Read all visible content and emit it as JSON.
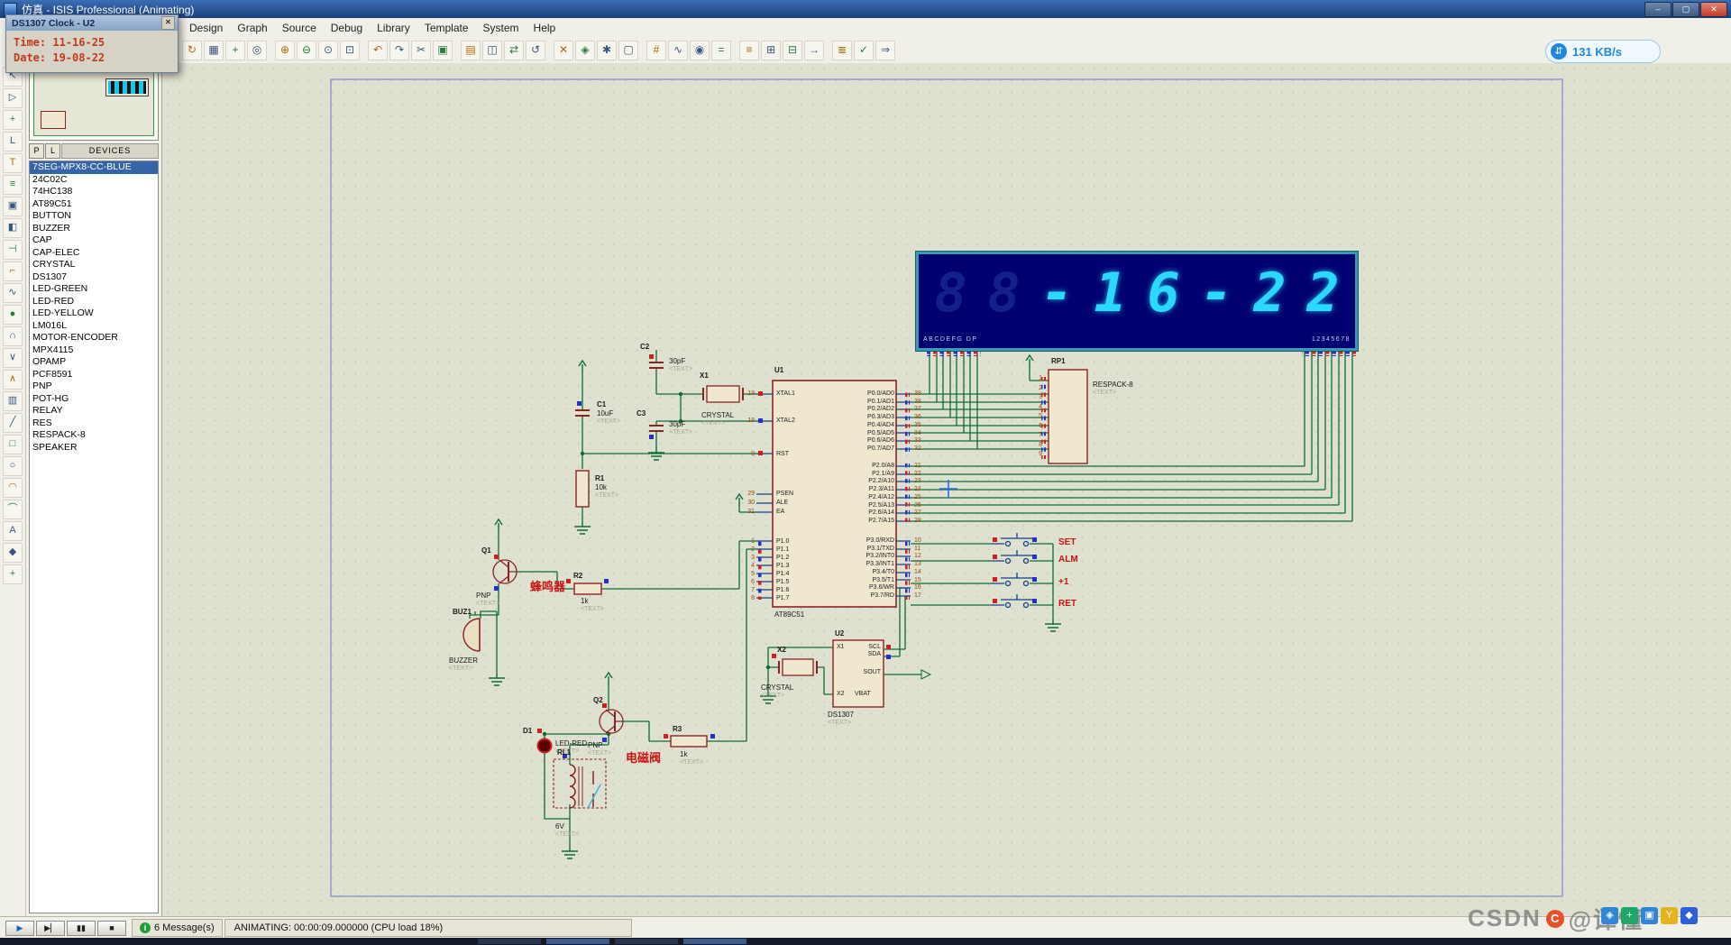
{
  "titlebar": {
    "title": "仿真 - ISIS Professional (Animating)",
    "window_controls": [
      {
        "name": "minimize-button",
        "glyph": "–"
      },
      {
        "name": "maximize-button",
        "glyph": "▢"
      },
      {
        "name": "close-button",
        "glyph": "✕"
      }
    ]
  },
  "popup": {
    "title": "DS1307 Clock - U2",
    "close_glyph": "✕",
    "lines": [
      "Time: 11-16-25",
      "Date: 19-08-22"
    ]
  },
  "menubar": {
    "items": [
      "Design",
      "Graph",
      "Source",
      "Debug",
      "Library",
      "Template",
      "System",
      "Help"
    ]
  },
  "toolbar": {
    "icons": [
      {
        "name": "redraw-icon",
        "glyph": "↻"
      },
      {
        "name": "grid-toggle-icon",
        "glyph": "▦"
      },
      {
        "name": "false-origin-icon",
        "glyph": "+"
      },
      {
        "name": "pan-icon",
        "glyph": "◎"
      },
      {
        "name": "zoom-in-icon",
        "glyph": "⊕"
      },
      {
        "name": "zoom-out-icon",
        "glyph": "⊖"
      },
      {
        "name": "zoom-all-icon",
        "glyph": "⊙"
      },
      {
        "name": "zoom-area-icon",
        "glyph": "⊡"
      },
      {
        "name": "undo-icon",
        "glyph": "↶"
      },
      {
        "name": "redo-icon",
        "glyph": "↷"
      },
      {
        "name": "cut-icon",
        "glyph": "✂"
      },
      {
        "name": "copy-icon",
        "glyph": "▣"
      },
      {
        "name": "paste-icon",
        "glyph": "▤"
      },
      {
        "name": "block-copy-icon",
        "glyph": "◫"
      },
      {
        "name": "block-move-icon",
        "glyph": "⇄"
      },
      {
        "name": "block-rotate-icon",
        "glyph": "↺"
      },
      {
        "name": "block-delete-icon",
        "glyph": "✕"
      },
      {
        "name": "pick-device-icon",
        "glyph": "◈"
      },
      {
        "name": "make-device-icon",
        "glyph": "✱"
      },
      {
        "name": "packaging-tool-icon",
        "glyph": "▢"
      },
      {
        "name": "decompose-icon",
        "glyph": "#"
      },
      {
        "name": "wire-autorouter-icon",
        "glyph": "∿"
      },
      {
        "name": "search-tag-icon",
        "glyph": "◉"
      },
      {
        "name": "property-assignment-icon",
        "glyph": "="
      },
      {
        "name": "design-explorer-icon",
        "glyph": "≡"
      },
      {
        "name": "new-sheet-icon",
        "glyph": "⊞"
      },
      {
        "name": "remove-sheet-icon",
        "glyph": "⊟"
      },
      {
        "name": "goto-sheet-icon",
        "glyph": "→"
      },
      {
        "name": "bom-icon",
        "glyph": "≣"
      },
      {
        "name": "electrical-check-icon",
        "glyph": "✓"
      },
      {
        "name": "netlist-to-ares-icon",
        "glyph": "⇒"
      }
    ],
    "net_badge": {
      "icon_glyph": "⇵",
      "speed": "131 KB/s"
    }
  },
  "modebar": {
    "icons": [
      {
        "name": "selection-mode-icon",
        "glyph": "↖"
      },
      {
        "name": "component-mode-icon",
        "glyph": "▷"
      },
      {
        "name": "junction-dot-mode-icon",
        "glyph": "+"
      },
      {
        "name": "wire-label-mode-icon",
        "glyph": "L"
      },
      {
        "name": "text-script-mode-icon",
        "glyph": "T"
      },
      {
        "name": "buses-mode-icon",
        "glyph": "≡"
      },
      {
        "name": "subcircuit-mode-icon",
        "glyph": "▣"
      },
      {
        "name": "instant-edit-mode-icon",
        "glyph": "◧"
      },
      {
        "name": "intersheet-terminal-mode-icon",
        "glyph": "⊣"
      },
      {
        "name": "device-pins-mode-icon",
        "glyph": "⌐"
      },
      {
        "name": "graph-mode-icon",
        "glyph": "∿"
      },
      {
        "name": "tape-recorder-mode-icon",
        "glyph": "●"
      },
      {
        "name": "generator-mode-icon",
        "glyph": "∩"
      },
      {
        "name": "voltage-probe-mode-icon",
        "glyph": "∨"
      },
      {
        "name": "current-probe-mode-icon",
        "glyph": "∧"
      },
      {
        "name": "virtual-instruments-mode-icon",
        "glyph": "▥"
      },
      {
        "name": "2d-line-mode-icon",
        "glyph": "╱"
      },
      {
        "name": "2d-box-mode-icon",
        "glyph": "□"
      },
      {
        "name": "2d-circle-mode-icon",
        "glyph": "○"
      },
      {
        "name": "2d-arc-mode-icon",
        "glyph": "◠"
      },
      {
        "name": "2d-path-mode-icon",
        "glyph": "⌒"
      },
      {
        "name": "2d-text-mode-icon",
        "glyph": "A"
      },
      {
        "name": "2d-symbol-mode-icon",
        "glyph": "◆"
      },
      {
        "name": "2d-marker-mode-icon",
        "glyph": "+"
      }
    ]
  },
  "panel": {
    "pl_buttons": [
      "P",
      "L"
    ],
    "header": "DEVICES",
    "devices": [
      "7SEG-MPX8-CC-BLUE",
      "24C02C",
      "74HC138",
      "AT89C51",
      "BUTTON",
      "BUZZER",
      "CAP",
      "CAP-ELEC",
      "CRYSTAL",
      "DS1307",
      "LED-GREEN",
      "LED-RED",
      "LED-YELLOW",
      "LM016L",
      "MOTOR-ENCODER",
      "MPX4115",
      "OPAMP",
      "PCF8591",
      "PNP",
      "POT-HG",
      "RELAY",
      "RES",
      "RESPACK-8",
      "SPEAKER"
    ]
  },
  "display": {
    "digits": [
      "8",
      "8",
      "-",
      "1",
      "6",
      "-",
      "2",
      "2"
    ],
    "segment_label": "ABCDEFG DP",
    "digit_label": "12345678"
  },
  "circuit": {
    "u1": {
      "ref": "U1",
      "part": "AT89C51",
      "xtal": [
        {
          "n": "19",
          "name": "XTAL1"
        },
        {
          "n": "18",
          "name": "XTAL2"
        }
      ],
      "rst": [
        {
          "n": "9",
          "name": "RST"
        }
      ],
      "ctrl": [
        {
          "n": "29",
          "name": "PSEN"
        },
        {
          "n": "30",
          "name": "ALE"
        },
        {
          "n": "31",
          "name": "EA"
        }
      ],
      "p1": [
        {
          "n": "1",
          "name": "P1.0"
        },
        {
          "n": "2",
          "name": "P1.1"
        },
        {
          "n": "3",
          "name": "P1.2"
        },
        {
          "n": "4",
          "name": "P1.3"
        },
        {
          "n": "5",
          "name": "P1.4"
        },
        {
          "n": "6",
          "name": "P1.5"
        },
        {
          "n": "7",
          "name": "P1.6"
        },
        {
          "n": "8",
          "name": "P1.7"
        }
      ],
      "p0": [
        {
          "n": "39",
          "name": "P0.0/AD0"
        },
        {
          "n": "38",
          "name": "P0.1/AD1"
        },
        {
          "n": "37",
          "name": "P0.2/AD2"
        },
        {
          "n": "36",
          "name": "P0.3/AD3"
        },
        {
          "n": "35",
          "name": "P0.4/AD4"
        },
        {
          "n": "34",
          "name": "P0.5/AD5"
        },
        {
          "n": "33",
          "name": "P0.6/AD6"
        },
        {
          "n": "32",
          "name": "P0.7/AD7"
        }
      ],
      "p2": [
        {
          "n": "21",
          "name": "P2.0/A8"
        },
        {
          "n": "22",
          "name": "P2.1/A9"
        },
        {
          "n": "23",
          "name": "P2.2/A10"
        },
        {
          "n": "24",
          "name": "P2.3/A11"
        },
        {
          "n": "25",
          "name": "P2.4/A12"
        },
        {
          "n": "26",
          "name": "P2.5/A13"
        },
        {
          "n": "27",
          "name": "P2.6/A14"
        },
        {
          "n": "28",
          "name": "P2.7/A15"
        }
      ],
      "p3": [
        {
          "n": "10",
          "name": "P3.0/RXD"
        },
        {
          "n": "11",
          "name": "P3.1/TXD"
        },
        {
          "n": "12",
          "name": "P3.2/INT0"
        },
        {
          "n": "13",
          "name": "P3.3/INT1"
        },
        {
          "n": "14",
          "name": "P3.4/T0"
        },
        {
          "n": "15",
          "name": "P3.5/T1"
        },
        {
          "n": "16",
          "name": "P3.6/WR"
        },
        {
          "n": "17",
          "name": "P3.7/RD"
        }
      ]
    },
    "u2": {
      "ref": "U2",
      "part": "DS1307",
      "text": "<TEXT>",
      "left": [
        "X1",
        "X2"
      ],
      "right": [
        "SCL",
        "SDA",
        "SOUT"
      ],
      "bottom": "VBAT"
    },
    "rp1": {
      "ref": "RP1",
      "part": "RESPACK-8",
      "text": "<TEXT>",
      "pins": [
        "1",
        "2",
        "3",
        "4",
        "5",
        "6",
        "7",
        "8",
        "9"
      ]
    },
    "parts": {
      "c1": {
        "ref": "C1",
        "val": "10uF",
        "text": "<TEXT>"
      },
      "c2": {
        "ref": "C2",
        "val": "30pF",
        "text": "<TEXT>"
      },
      "c3": {
        "ref": "C3",
        "val": "30pF",
        "text": "<TEXT>"
      },
      "r1": {
        "ref": "R1",
        "val": "10k",
        "text": "<TEXT>"
      },
      "r2": {
        "ref": "R2",
        "val": "1k",
        "text": "<TEXT>"
      },
      "r3": {
        "ref": "R3",
        "val": "1k",
        "text": "<TEXT>"
      },
      "x1": {
        "ref": "X1",
        "val": "CRYSTAL",
        "text": "<TEXT>"
      },
      "x2": {
        "ref": "X2",
        "val": "CRYSTAL",
        "text": "<TEXT>"
      },
      "q1": {
        "ref": "Q1",
        "val": "PNP",
        "text": "<TEXT>"
      },
      "q2": {
        "ref": "Q2",
        "val": "PNP",
        "text": "<TEXT>"
      },
      "buz1": {
        "ref": "BUZ1",
        "val": "BUZZER",
        "text": "<TEXT>"
      },
      "d1": {
        "ref": "D1",
        "val": "LED-RED",
        "text": "<TEXT>"
      },
      "rl1": {
        "ref": "RL1",
        "val": "6V",
        "text": "<TEXT>"
      }
    },
    "buttons": [
      "SET",
      "ALM",
      "+1",
      "RET"
    ],
    "labels": {
      "buzzer": "蜂鸣器",
      "valve": "电磁阀"
    }
  },
  "simbar": {
    "buttons": [
      {
        "name": "play-button",
        "glyph": "▶"
      },
      {
        "name": "step-button",
        "glyph": "▶▏"
      },
      {
        "name": "pause-button",
        "glyph": "▮▮"
      },
      {
        "name": "stop-button",
        "glyph": "■"
      }
    ],
    "info_glyph": "i",
    "messages": "6 Message(s)",
    "status": "ANIMATING: 00:00:09.000000 (CPU load 18%)"
  },
  "watermark": {
    "text": "CSDN",
    "logo_glyph": "C",
    "handle": "@谭懂"
  },
  "tray_icons": [
    {
      "name": "tray-icon-1",
      "glyph": "◈"
    },
    {
      "name": "tray-icon-2",
      "glyph": "+"
    },
    {
      "name": "tray-icon-3",
      "glyph": "▣"
    },
    {
      "name": "tray-icon-4",
      "glyph": "Y"
    },
    {
      "name": "tray-icon-5",
      "glyph": "◆"
    }
  ],
  "colors": {
    "canvas": "#dee0d0",
    "wire": "#0e6b33",
    "component_outline": "#8b2323",
    "display_bg": "#000070",
    "display_digit": "#2bd9ff",
    "selection": "#3565a8",
    "state_high": "#cf2020",
    "state_low": "#2431c8"
  }
}
